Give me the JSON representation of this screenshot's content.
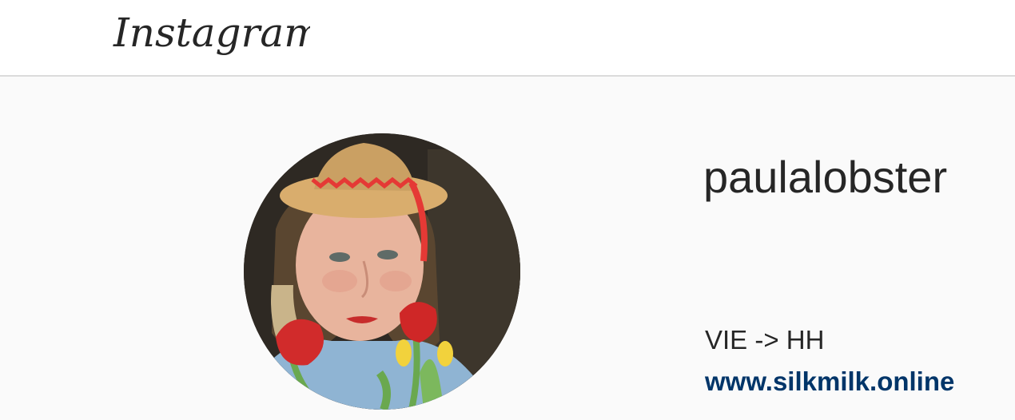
{
  "header": {
    "logo_text": "Instagram"
  },
  "profile": {
    "avatar_icon": "profile-photo",
    "username": "paulalobster",
    "bio": "VIE -> HH",
    "website": "www.silkmilk.online"
  },
  "colors": {
    "header_bg": "#ffffff",
    "page_bg": "#fafafa",
    "border": "#dbdbdb",
    "text": "#262626",
    "link": "#003569"
  }
}
